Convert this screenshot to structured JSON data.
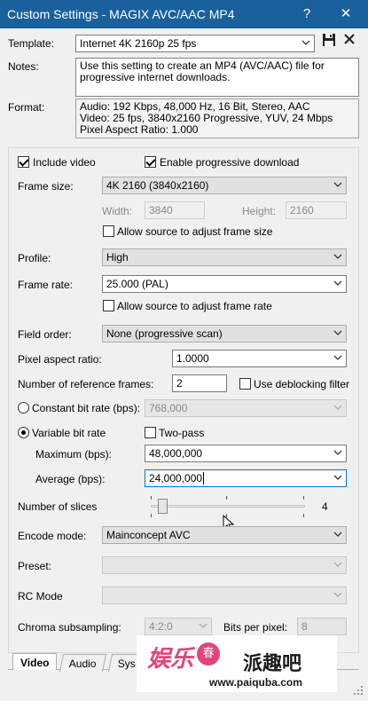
{
  "window": {
    "title": "Custom Settings - MAGIX AVC/AAC MP4",
    "help": "?",
    "close": "✕"
  },
  "template": {
    "label": "Template:",
    "value": "Internet 4K 2160p 25 fps"
  },
  "notes": {
    "label": "Notes:",
    "line1": "Use this setting to create an MP4 (AVC/AAC) file for",
    "line2": "progressive internet downloads."
  },
  "format": {
    "label": "Format:",
    "line1": "Audio: 192 Kbps, 48,000 Hz, 16 Bit, Stereo, AAC",
    "line2": "Video: 25 fps, 3840x2160 Progressive, YUV, 24 Mbps",
    "line3": "Pixel Aspect Ratio: 1.000"
  },
  "video": {
    "include_video": "Include video",
    "progressive_download": "Enable progressive download",
    "frame_size_label": "Frame size:",
    "frame_size_value": "4K 2160 (3840x2160)",
    "width_label": "Width:",
    "width_value": "3840",
    "height_label": "Height:",
    "height_value": "2160",
    "allow_frame_size": "Allow source to adjust frame size",
    "profile_label": "Profile:",
    "profile_value": "High",
    "frame_rate_label": "Frame rate:",
    "frame_rate_value": "25.000 (PAL)",
    "allow_frame_rate": "Allow source to adjust frame rate",
    "field_order_label": "Field order:",
    "field_order_value": "None (progressive scan)",
    "pixel_aspect_label": "Pixel aspect ratio:",
    "pixel_aspect_value": "1.0000",
    "ref_frames_label": "Number of reference frames:",
    "ref_frames_value": "2",
    "deblocking": "Use deblocking filter",
    "cbr_label": "Constant bit rate (bps):",
    "cbr_value": "768,000",
    "vbr_label": "Variable bit rate",
    "two_pass": "Two-pass",
    "max_label": "Maximum (bps):",
    "max_value": "48,000,000",
    "avg_label": "Average (bps):",
    "avg_value": "24,000,000",
    "slices_label": "Number of slices",
    "slices_value": "4",
    "slices_fraction": 0.05,
    "encode_label": "Encode mode:",
    "encode_value": "Mainconcept AVC",
    "preset_label": "Preset:",
    "rc_label": "RC Mode",
    "chroma_label": "Chroma subsampling:",
    "chroma_value": "4:2:0",
    "bpp_label": "Bits per pixel:",
    "bpp_value": "8"
  },
  "tabs": [
    "Video",
    "Audio",
    "Sys"
  ],
  "watermark": {
    "brand_cn": "娱乐",
    "badge": "春",
    "site_cn": "派趣吧",
    "url": "www.paiquba.com"
  },
  "colors": {
    "titlebar": "#19619c",
    "watermark_pink": "#e0457b",
    "watermark_dark": "#1a1a1a"
  }
}
